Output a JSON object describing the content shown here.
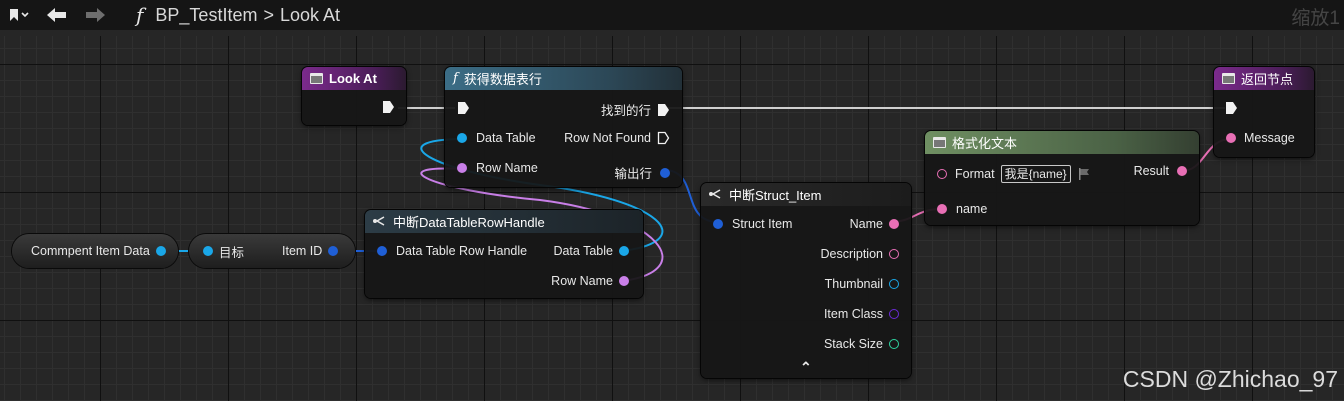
{
  "toolbar": {
    "bookmark_icon": "bookmark-icon",
    "back_icon": "arrow-left-icon",
    "forward_icon": "arrow-right-icon",
    "function_icon": "f",
    "breadcrumb_blueprint": "BP_TestItem",
    "breadcrumb_separator": ">",
    "breadcrumb_function": "Look At",
    "zoom_label": "缩放1"
  },
  "nodes": {
    "look_at": {
      "title": "Look At"
    },
    "get_data_table_row": {
      "icon": "f",
      "title": "获得数据表行",
      "pin_data_table": "Data Table",
      "pin_row_name": "Row Name",
      "pin_row_found": "找到的行",
      "pin_row_not_found": "Row Not Found",
      "pin_out_row": "输出行"
    },
    "return_node": {
      "title": "返回节点",
      "pin_message": "Message"
    },
    "format_text": {
      "title": "格式化文本",
      "pin_format": "Format",
      "format_value": "我是{name}",
      "pin_name": "name",
      "pin_result": "Result"
    },
    "break_struct_item": {
      "title": "中断Struct_Item",
      "pin_struct_item": "Struct Item",
      "pin_name": "Name",
      "pin_description": "Description",
      "pin_thumbnail": "Thumbnail",
      "pin_item_class": "Item Class",
      "pin_stack_size": "Stack Size",
      "collapse_glyph": "⌃"
    },
    "break_row_handle": {
      "title": "中断DataTableRowHandle",
      "pin_handle": "Data Table Row Handle",
      "pin_data_table": "Data Table",
      "pin_row_name": "Row Name"
    },
    "comment_item_data": {
      "label": "Commpent Item Data"
    },
    "get_item_id": {
      "pin_target": "目标",
      "pin_item_id": "Item ID"
    }
  },
  "watermark": "CSDN @Zhichao_97",
  "colors": {
    "pin_struct": "#1aa7e8",
    "pin_text": "#e86fb5",
    "pin_object": "#1f5fd6",
    "pin_name": "#c97fe8",
    "pin_class": "#6a2bd6",
    "pin_int": "#2ed3a0",
    "header_function": "#3b6d86",
    "header_entry": "#7b2a8c",
    "header_format": "#6f8f62"
  }
}
